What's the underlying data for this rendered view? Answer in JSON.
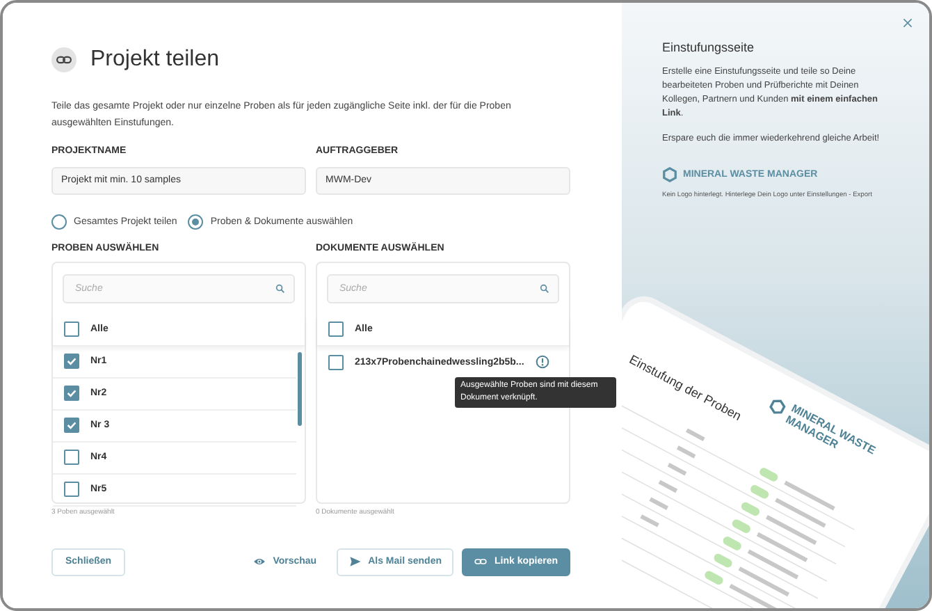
{
  "dialog": {
    "title": "Projekt teilen",
    "description": "Teile das gesamte Projekt oder nur einzelne Proben als für jeden zugängliche Seite inkl. der für die Proben ausgewählten Einstufungen.",
    "fields": [
      {
        "label": "PROJEKTNAME",
        "value": "Projekt mit min. 10 samples"
      },
      {
        "label": "AUFTRAGGEBER",
        "value": "MWM-Dev"
      }
    ],
    "share_options": [
      {
        "label": "Gesamtes Projekt teilen",
        "selected": false
      },
      {
        "label": "Proben & Dokumente auswählen",
        "selected": true
      }
    ],
    "lists": [
      {
        "title": "PROBEN AUSWÄHLEN",
        "search": {
          "placeholder": "Suche"
        },
        "select_all": {
          "label": "Alle",
          "checked": false
        },
        "items": [
          {
            "label": "Nr1",
            "checked": true,
            "info": false
          },
          {
            "label": "Nr2",
            "checked": true,
            "info": false
          },
          {
            "label": "Nr 3",
            "checked": true,
            "info": false
          },
          {
            "label": "Nr4",
            "checked": false,
            "info": false
          },
          {
            "label": "Nr5",
            "checked": false,
            "info": false
          }
        ],
        "count": "3 Poben ausgewählt"
      },
      {
        "title": "DOKUMENTE AUSWÄHLEN",
        "search": {
          "placeholder": "Suche"
        },
        "select_all": {
          "label": "Alle",
          "checked": false
        },
        "items": [
          {
            "label": "213x7Probenchainedwessling2b5b...",
            "checked": false,
            "info": true
          }
        ],
        "tooltip": "Ausgewählte Proben sind mit diesem Dokument verknüpft.",
        "count": "0 Dokumente ausgewählt"
      }
    ],
    "buttons": [
      {
        "kind": "close",
        "label": "Schließen"
      },
      {
        "kind": "preview",
        "label": "Vorschau"
      },
      {
        "kind": "mail",
        "label": "Als Mail senden"
      },
      {
        "kind": "copy",
        "label": "Link kopieren"
      }
    ]
  },
  "info_panel": {
    "title": "Einstufungsseite",
    "paragraphs": [
      "Erstelle eine Einstufungsseite und teile so Deine bearbeiteten Proben und Prüfberichte mit Deinen Kollegen, Partnern und Kunden **mit einem einfachen Link**.",
      "Erspare euch die immer wiederkehrend gleiche Arbeit!"
    ],
    "logo_text": "MINERAL WASTE MANAGER",
    "logo_note": "Kein Logo hinterlegt. Hinterlege Dein Logo unter Einstellungen - Export",
    "preview": {
      "logo_text": "MINERAL WASTE MANAGER",
      "title": "Einstufung der Proben"
    }
  }
}
